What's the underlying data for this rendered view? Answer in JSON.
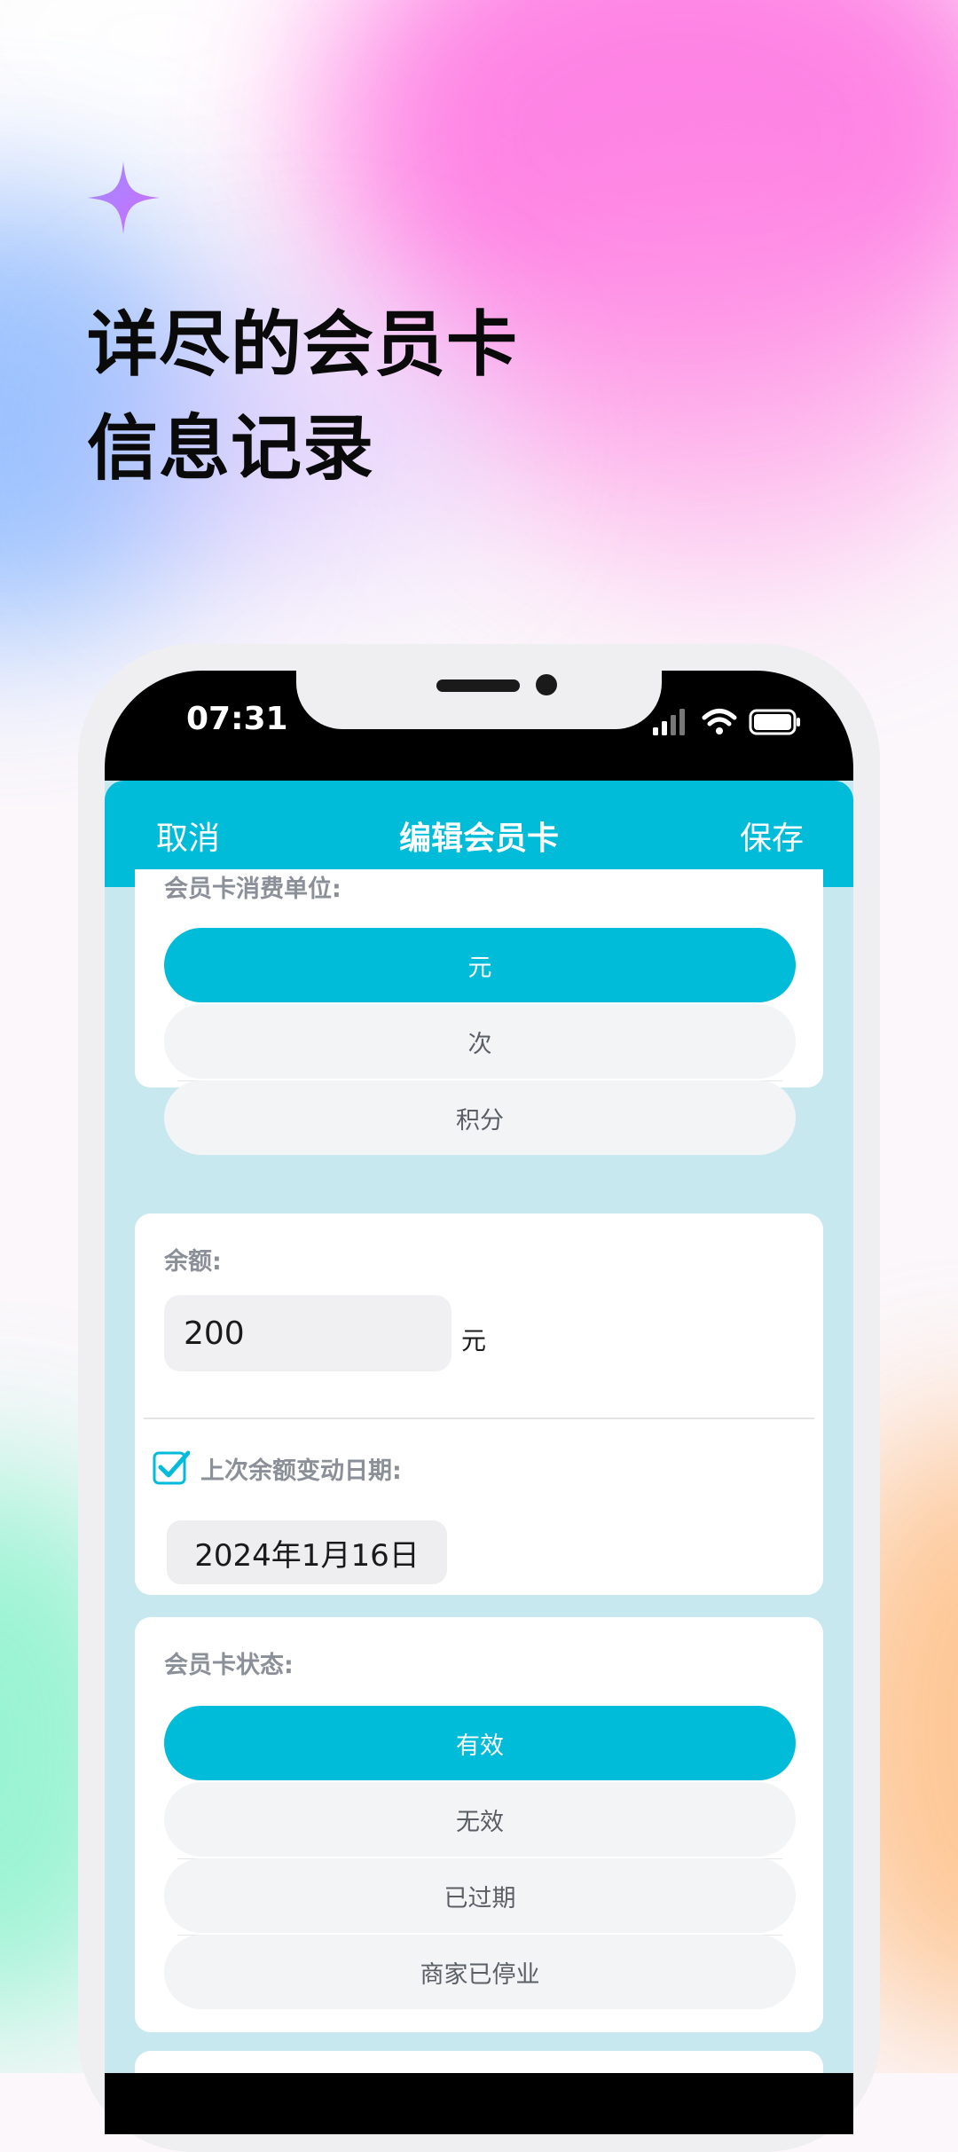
{
  "headline": {
    "line1": "详尽的会员卡",
    "line2": "信息记录"
  },
  "status_bar": {
    "time": "07:31"
  },
  "nav": {
    "cancel": "取消",
    "title": "编辑会员卡",
    "save": "保存"
  },
  "unit_section": {
    "label": "会员卡消费单位:",
    "options": [
      "元",
      "次",
      "积分"
    ],
    "selected": "元"
  },
  "balance_section": {
    "label": "余额:",
    "value": "200",
    "unit": "元",
    "last_change_checked": true,
    "last_change_label": "上次余额变动日期:",
    "last_change_date": "2024年1月16日"
  },
  "status_section": {
    "label": "会员卡状态:",
    "options": [
      "有效",
      "无效",
      "已过期",
      "商家已停业"
    ],
    "selected": "有效"
  },
  "colors": {
    "accent": "#00bcd9",
    "screen_bg": "#c8e8f0"
  }
}
